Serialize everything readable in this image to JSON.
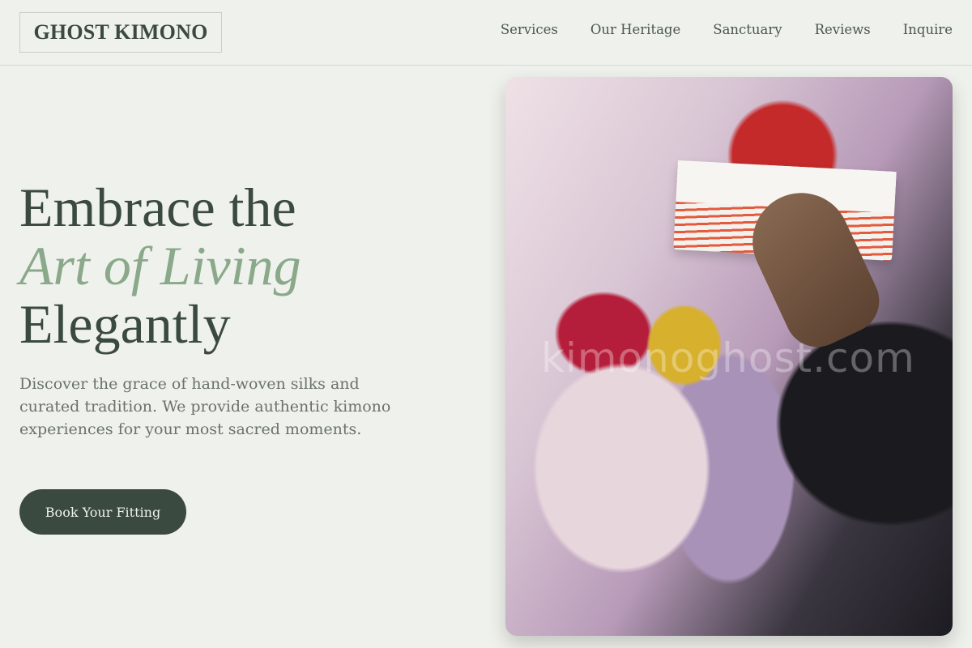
{
  "header": {
    "logo": "GHOST KIMONO",
    "nav": [
      "Services",
      "Our Heritage",
      "Sanctuary",
      "Reviews",
      "Inquire"
    ]
  },
  "hero": {
    "headline_line1": "Embrace the",
    "headline_accent": "Art of Living",
    "headline_line3": "Elegantly",
    "description": "Discover the grace of hand-woven silks and curated tradition. We provide authentic kimono experiences for your most sacred moments.",
    "cta_label": "Book Your Fitting"
  },
  "image": {
    "watermark": "kimonoghost.com"
  },
  "colors": {
    "background": "#eff1ec",
    "primary": "#3b4a40",
    "accent": "#8aa88a"
  }
}
